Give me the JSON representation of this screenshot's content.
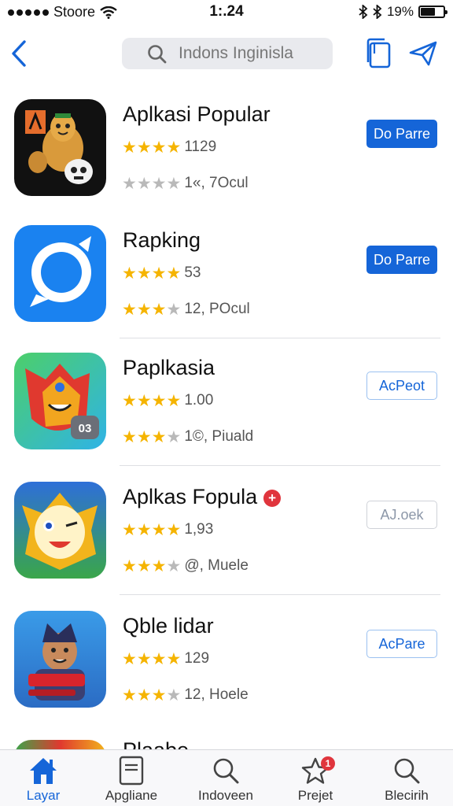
{
  "status_bar": {
    "carrier": "Stoore",
    "time": "1:.24",
    "battery_percent": "19%",
    "signal_bars": 5,
    "battery_level": 0.55
  },
  "nav": {
    "search_placeholder": "Indons Inginisla"
  },
  "apps": [
    {
      "name": "Aplkasi Popular",
      "rating_stars": 4,
      "rating_label": "1129",
      "subrating_stars": 0,
      "subrating_label": "1«, 7Ocul",
      "button_label": "Do Parre",
      "button_style": "solid"
    },
    {
      "name": "Rapking",
      "rating_stars": 4,
      "rating_label": "53",
      "subrating_stars": 3,
      "subrating_label": "12, POcul",
      "button_label": "Do Parre",
      "button_style": "solid"
    },
    {
      "name": "Paplkasia",
      "rating_stars": 4,
      "rating_label": "1.00",
      "subrating_stars": 3,
      "subrating_label": "1©, Piuald",
      "button_label": "AcPeot",
      "button_style": "outline"
    },
    {
      "name": "Aplkas Fopula",
      "rating_stars": 4,
      "rating_label": "1,93",
      "subrating_stars": 3,
      "subrating_label": "@, Muele",
      "button_label": "AJ.oek",
      "button_style": "outline-grey"
    },
    {
      "name": "Qble lidar",
      "rating_stars": 4,
      "rating_label": "129",
      "subrating_stars": 3,
      "subrating_label": "12, Hoele",
      "button_label": "AcPare",
      "button_style": "outline"
    },
    {
      "name": "Plaabe",
      "rating_stars": 0,
      "rating_label": "",
      "subrating_stars": 0,
      "subrating_label": "",
      "button_label": "",
      "button_style": "none"
    }
  ],
  "tabs": [
    {
      "label": "Layar",
      "icon": "home-icon",
      "active": true
    },
    {
      "label": "Apgliane",
      "icon": "document-icon",
      "active": false
    },
    {
      "label": "Indoveen",
      "icon": "search-icon",
      "active": false
    },
    {
      "label": "Prejet",
      "icon": "star-icon",
      "active": false,
      "badge": "1"
    },
    {
      "label": "Blecirih",
      "icon": "search-icon",
      "active": false
    }
  ],
  "colors": {
    "accent": "#1565d8",
    "star": "#f5b400",
    "badge": "#e0353d"
  }
}
